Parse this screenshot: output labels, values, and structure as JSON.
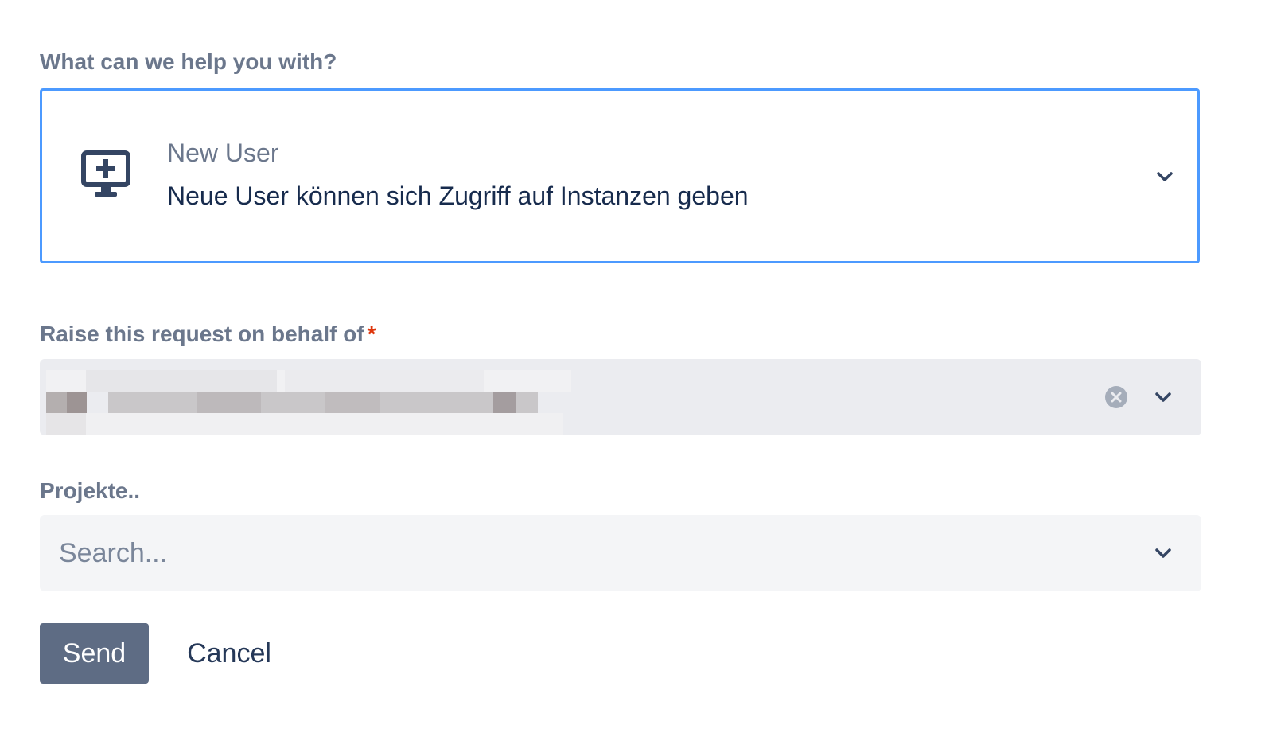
{
  "request_type": {
    "label": "What can we help you with?",
    "selected_title": "New User",
    "selected_description": "Neue User können sich Zugriff auf Instanzen geben",
    "icon": "monitor-add-icon"
  },
  "on_behalf": {
    "label": "Raise this request on behalf of",
    "required_marker": "*",
    "value_redacted": true
  },
  "projects": {
    "label": "Projekte..",
    "placeholder": "Search..."
  },
  "actions": {
    "send_label": "Send",
    "cancel_label": "Cancel"
  },
  "colors": {
    "focus_border": "#4c9aff",
    "label": "#6b778c",
    "text": "#172b4d",
    "required": "#de350b",
    "primary_button": "#5e6c84",
    "field_bg": "#f4f5f7"
  }
}
